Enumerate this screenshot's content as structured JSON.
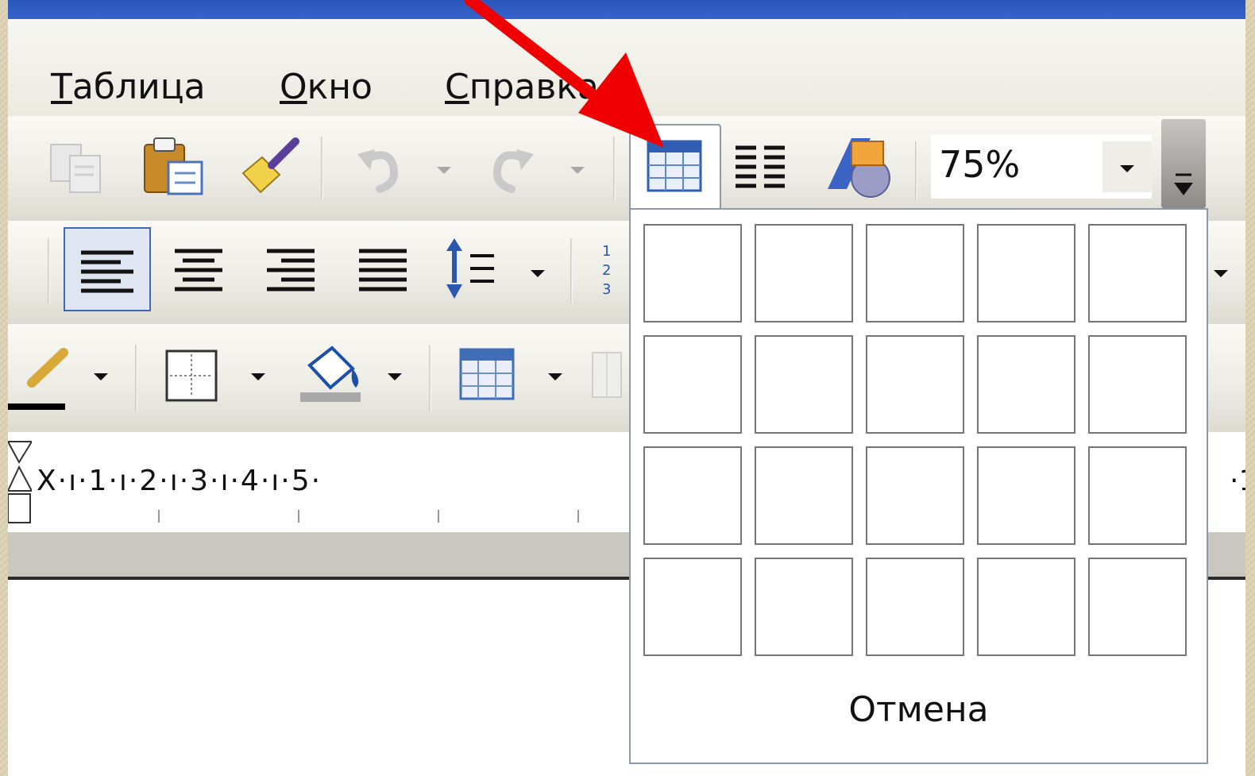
{
  "menu": {
    "items": [
      {
        "label": "Таблица",
        "accel": "Т",
        "rest": "аблица"
      },
      {
        "label": "Окно",
        "accel": "О",
        "rest": "кно"
      },
      {
        "label": "Справка",
        "accel": "С",
        "rest": "правка"
      }
    ]
  },
  "toolbar": {
    "zoom_value": "75%"
  },
  "ruler": {
    "text": "X·ı·1·ı·2·ı·3·ı·4·ı·5·",
    "right_text": "·1"
  },
  "insert_table_popup": {
    "rows": 4,
    "columns": 5,
    "cancel_label": "Отмена"
  },
  "colors": {
    "annotation_arrow": "#f00000",
    "titlebar": "#2b55b8"
  },
  "icons": [
    "copy-icon",
    "paste-icon",
    "format-painter-icon",
    "undo-icon",
    "redo-icon",
    "insert-table-icon",
    "columns-icon",
    "drawing-icon",
    "align-left-icon",
    "align-center-icon",
    "align-right-icon",
    "justify-icon",
    "line-spacing-icon",
    "numbering-icon",
    "line-color-icon",
    "borders-icon",
    "shading-icon",
    "table-icon"
  ]
}
